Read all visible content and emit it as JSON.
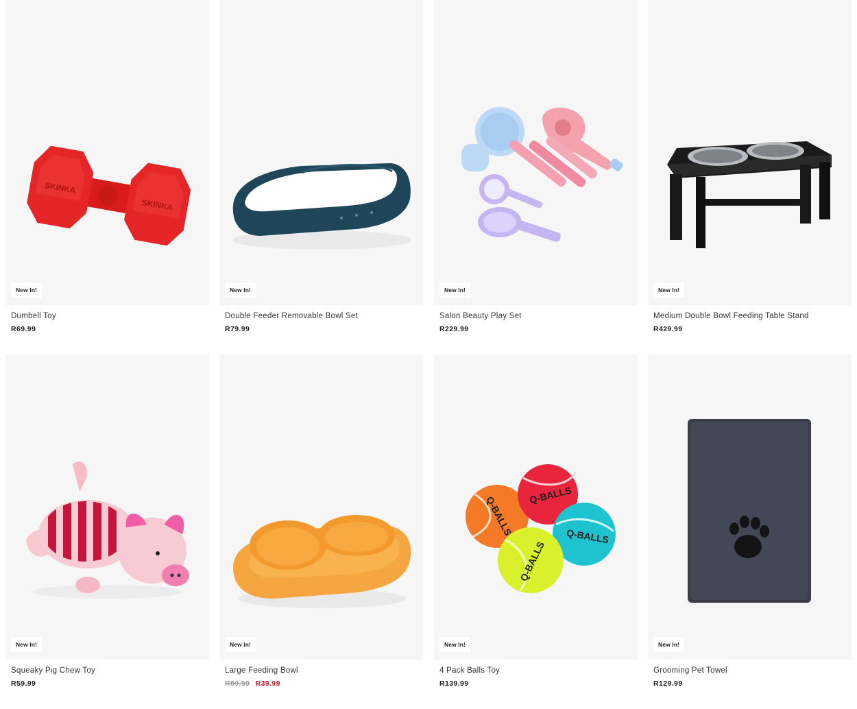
{
  "products": [
    {
      "name": "Dumbell Toy",
      "badge": "New In!",
      "price": "R69.99"
    },
    {
      "name": "Double Feeder Removable Bowl Set",
      "badge": "New In!",
      "price": "R79.99"
    },
    {
      "name": "Salon Beauty Play Set",
      "badge": "New In!",
      "price": "R229.99"
    },
    {
      "name": "Medium Double Bowl Feeding Table Stand",
      "badge": "New In!",
      "price": "R429.99"
    },
    {
      "name": "Squeaky Pig Chew Toy",
      "badge": "New In!",
      "price": "R59.99"
    },
    {
      "name": "Large Feeding Bowl",
      "badge": "New In!",
      "price_old": "R89.99",
      "price": "R39.99"
    },
    {
      "name": "4 Pack Balls Toy",
      "badge": "New In!",
      "price": "R139.99"
    },
    {
      "name": "Grooming Pet Towel",
      "badge": "New In!",
      "price": "R129.99"
    }
  ],
  "image_text": {
    "dumbbell_brand": "SKINKA",
    "ball_brand": "Q-BALLS"
  },
  "colors": {
    "card_bg": "#f6f6f7",
    "sale_price": "#d0112b",
    "old_price": "#9a9a9a"
  }
}
